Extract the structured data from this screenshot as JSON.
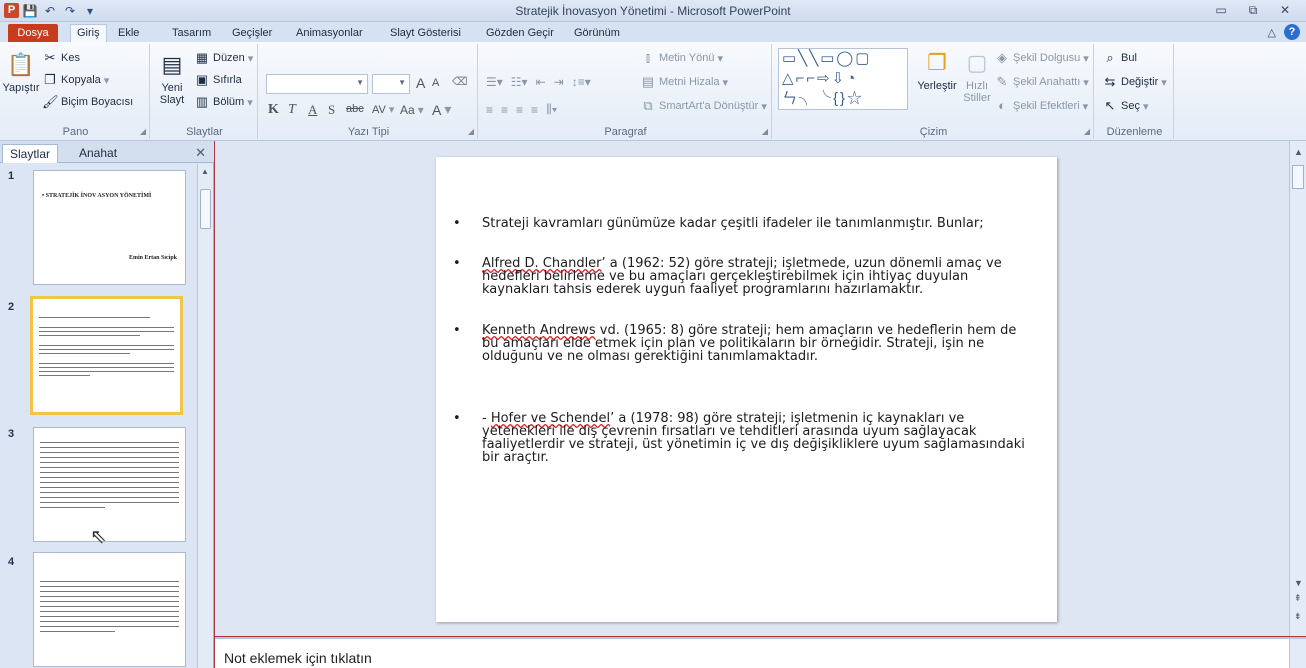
{
  "window": {
    "title": "Stratejik İnovasyon Yönetimi  -  Microsoft PowerPoint",
    "logo": "P",
    "controls": [
      "▭",
      "⧉",
      "✕"
    ]
  },
  "qat": {
    "save": "💾",
    "undo": "↶",
    "redo": "↷",
    "customize": "▾"
  },
  "tabs": {
    "file": "Dosya",
    "items": [
      "Giriş",
      "Ekle",
      "Tasarım",
      "Geçişler",
      "Animasyonlar",
      "Slayt Gösterisi",
      "Gözden Geçir",
      "Görünüm"
    ],
    "minimize": "△",
    "help": "?"
  },
  "ribbon": {
    "pano": {
      "label": "Pano",
      "paste": "Yapıştır",
      "cut": "Kes",
      "copy": "Kopyala",
      "format_painter": "Biçim Boyacısı"
    },
    "slaytlar": {
      "label": "Slaytlar",
      "new_slide_1": "Yeni",
      "new_slide_2": "Slayt",
      "layout": "Düzen",
      "reset": "Sıfırla",
      "section": "Bölüm"
    },
    "font": {
      "label": "Yazı Tipi",
      "grow": "A",
      "shrink": "A",
      "bold": "K",
      "italic": "T",
      "underline": "A",
      "shadow": "S",
      "strike": "abc",
      "spacing": "AV",
      "case": "Aa",
      "color": "A"
    },
    "paragraf": {
      "label": "Paragraf",
      "text_direction": "Metin Yönü",
      "align_text": "Metni Hizala",
      "smartart": "SmartArt'a Dönüştür"
    },
    "cizim": {
      "label": "Çizim",
      "arrange": "Yerleştir",
      "quick_styles_1": "Hızlı",
      "quick_styles_2": "Stiller",
      "fill": "Şekil Dolgusu",
      "outline": "Şekil Anahattı",
      "effects": "Şekil Efektleri"
    },
    "duzenleme": {
      "label": "Düzenleme",
      "find": "Bul",
      "replace": "Değiştir",
      "select": "Seç"
    }
  },
  "panel": {
    "tab_slides": "Slaytlar",
    "tab_outline": "Anahat",
    "close": "✕",
    "thumbs": [
      {
        "num": "1",
        "title": "•  STRATEJİK İNOV ASYON YÖNETİMİ",
        "author": "Emin Ertan Sıcipk"
      },
      {
        "num": "2"
      },
      {
        "num": "3"
      },
      {
        "num": "4"
      }
    ]
  },
  "slide": {
    "bullets": [
      {
        "dot": "•",
        "text": "Strateji kavramları günümüze kadar çeşitli ifadeler ile tanımlanmıştır. Bunlar;"
      },
      {
        "dot": "•",
        "underlined": "Alfred D. Chandler",
        "text": "’ a (1962: 52) göre strateji; işletmede, uzun dönemli amaç ve hedefleri belirleme ve bu amaçları gerçekleştirebilmek için ihtiyaç duyulan kaynakları tahsis ederek uygun faaliyet programlarını hazırlamaktır."
      },
      {
        "dot": "•",
        "underlined": "Kenneth Andrews",
        "text": " vd. (1965: 8) göre strateji; hem amaçların ve hedeflerin hem de bu amaçları elde etmek için plan ve politikaların bir örneğidir. Strateji, işin ne olduğunu ve ne olması gerektiğini tanımlamaktadır."
      },
      {
        "dot": "•",
        "prefix": "- ",
        "underlined": "Hofer ve Schendel",
        "text": "’ a (1978: 98) göre strateji; işletmenin iç kaynakları ve yetenekleri ile dış çevrenin fırsatları ve tehditleri arasında uyum sağlayacak faaliyetlerdir ve strateji, üst yönetimin iç ve dış değişikliklere uyum sağlamasındaki bir araçtır."
      }
    ]
  },
  "notes": {
    "placeholder": "Not eklemek için tıklatın"
  },
  "colors": {
    "title_bar": "#dfe8f5",
    "file_tab": "#c73c1f",
    "selection": "#f3c44a",
    "background": "#a73b44"
  }
}
